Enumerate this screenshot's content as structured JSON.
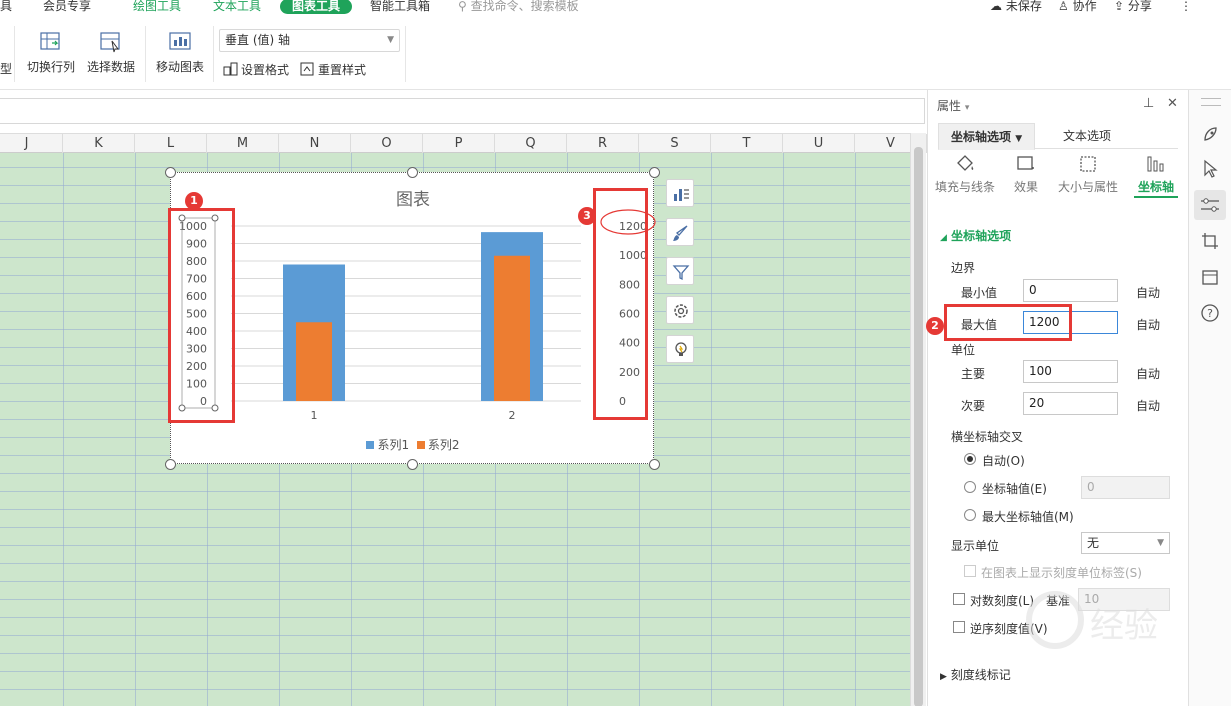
{
  "menu": {
    "tool_left": "具",
    "member": "会员专享",
    "draw_tools": "绘图工具",
    "text_tools": "文本工具",
    "chart_tools": "图表工具",
    "smart_tools": "智能工具箱",
    "search_placeholder": "查找命令、搜索模板",
    "unsaved": "未保存",
    "collab": "协作",
    "share": "分享"
  },
  "toolbar": {
    "cut_left": "型",
    "switch_row_col": "切换行列",
    "select_data": "选择数据",
    "move_chart": "移动图表",
    "axis_select": "垂直 (值) 轴",
    "set_format": "设置格式",
    "reset_style": "重置样式"
  },
  "columns": [
    "J",
    "K",
    "L",
    "M",
    "N",
    "O",
    "P",
    "Q",
    "R",
    "S",
    "T",
    "U",
    "V"
  ],
  "chart_data": {
    "type": "bar",
    "title": "图表",
    "categories": [
      "1",
      "2"
    ],
    "series": [
      {
        "name": "系列1",
        "values": [
          780,
          965
        ],
        "color": "#5b9bd5"
      },
      {
        "name": "系列2",
        "values": [
          450,
          830
        ],
        "color": "#ed7d31"
      }
    ],
    "primary_axis": {
      "ticks": [
        "1000",
        "900",
        "800",
        "700",
        "600",
        "500",
        "400",
        "300",
        "200",
        "100",
        "0"
      ],
      "ylim": [
        0,
        1000
      ]
    },
    "secondary_axis": {
      "ticks": [
        "1200",
        "1000",
        "800",
        "600",
        "400",
        "200",
        "0"
      ],
      "ylim": [
        0,
        1200
      ]
    },
    "grid": true,
    "legend": "bottom"
  },
  "badges": {
    "b1": "1",
    "b2": "2",
    "b3": "3"
  },
  "pane": {
    "title": "属性",
    "tab_axis": "坐标轴选项",
    "tab_text": "文本选项",
    "cat_fill": "填充与线条",
    "cat_effect": "效果",
    "cat_size": "大小与属性",
    "cat_axis": "坐标轴",
    "section": "坐标轴选项",
    "bounds": "边界",
    "min_label": "最小值",
    "min_value": "0",
    "max_label": "最大值",
    "max_value": "1200",
    "auto": "自动",
    "units": "单位",
    "major_label": "主要",
    "major_value": "100",
    "minor_label": "次要",
    "minor_value": "20",
    "cross": "横坐标轴交叉",
    "cross_auto": "自动(O)",
    "cross_value": "坐标轴值(E)",
    "cross_value_input": "0",
    "cross_max": "最大坐标轴值(M)",
    "display_unit": "显示单位",
    "display_unit_value": "无",
    "show_unit_label": "在图表上显示刻度单位标签(S)",
    "log_scale": "对数刻度(L)",
    "base": "基准",
    "base_value": "10",
    "reverse": "逆序刻度值(V)",
    "tick_marks": "刻度线标记"
  }
}
